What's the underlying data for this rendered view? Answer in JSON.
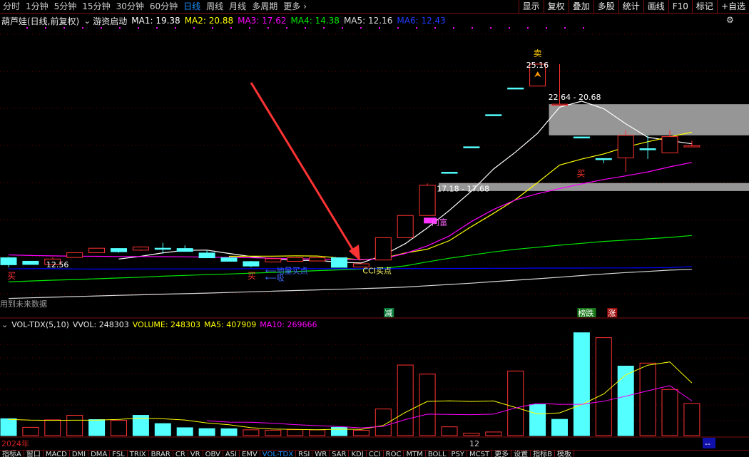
{
  "toolbar": {
    "periods": [
      {
        "label": "分时"
      },
      {
        "label": "1分钟"
      },
      {
        "label": "5分钟"
      },
      {
        "label": "15分钟"
      },
      {
        "label": "30分钟"
      },
      {
        "label": "60分钟"
      },
      {
        "label": "日线",
        "active": true
      },
      {
        "label": "周线"
      },
      {
        "label": "月线"
      },
      {
        "label": "多周期"
      },
      {
        "label": "更多"
      }
    ],
    "more_arrow": "›",
    "tools": [
      "显示",
      "复权",
      "叠加",
      "多股",
      "统计",
      "画线",
      "F10",
      "标记",
      "+自选"
    ]
  },
  "main_info": {
    "stock": "葫芦娃(日线,前复权)",
    "chevron": "⌄",
    "indicator": "游资启动",
    "ma1": "MA1: 19.38",
    "ma2": "MA2: 20.88",
    "ma3": "MA3: 17.62",
    "ma4": "MA4: 14.38",
    "ma5": "MA5: 12.16",
    "ma6": "MA6: 12.43",
    "settings_icon": "gear-icon"
  },
  "colors": {
    "up": "#ff3232",
    "down": "#54ffff",
    "ma1": "#ffffff",
    "ma2": "#ffff00",
    "ma3": "#ff00ff",
    "ma4": "#00e600",
    "ma5": "#0000ff",
    "ma6": "#0000ff",
    "zone": "#c0c0c0",
    "arrow": "#ff3333",
    "label_green": "#00cc66"
  },
  "annotations": {
    "high_price": "25.16",
    "low_price": "12.56",
    "zone_upper": "22.64 - 20.68",
    "zone_lower": "17.18 - 17.68",
    "sell_label": "卖",
    "buy_label": "买",
    "suck_label": "吸",
    "asking_label": "问富",
    "ground_buy": "地量买点",
    "cci_buy": "CCI买点",
    "future_data": "用到未来数据",
    "tag_reduce": "减",
    "tag_list": "榜跌",
    "tag_rise": "涨"
  },
  "volume_info": {
    "indicator": "VOL-TDX(5,10)",
    "vvol": "VVOL: 248303",
    "volume": "VOLUME: 248303",
    "ma5": "MA5: 407909",
    "ma10": "MA10: 269666"
  },
  "time_axis": {
    "year": "2024年",
    "month": "12",
    "right_marker": "--"
  },
  "bottom_tabs": [
    {
      "label": "指标A"
    },
    {
      "label": "窗口"
    },
    {
      "label": "MACD"
    },
    {
      "label": "DMI"
    },
    {
      "label": "DMA"
    },
    {
      "label": "FSL"
    },
    {
      "label": "TRIX"
    },
    {
      "label": "BRAR"
    },
    {
      "label": "CR"
    },
    {
      "label": "VR"
    },
    {
      "label": "OBV"
    },
    {
      "label": "ASI"
    },
    {
      "label": "EMV"
    },
    {
      "label": "VOL-TDX",
      "active": true
    },
    {
      "label": "RSI"
    },
    {
      "label": "WR"
    },
    {
      "label": "SAR"
    },
    {
      "label": "KDJ"
    },
    {
      "label": "CCI"
    },
    {
      "label": "ROC"
    },
    {
      "label": "MTM"
    },
    {
      "label": "BOLL"
    },
    {
      "label": "PSY"
    },
    {
      "label": "MCST"
    },
    {
      "label": "更多"
    },
    {
      "label": "设置"
    },
    {
      "label": "指标B"
    },
    {
      "label": "模板"
    }
  ],
  "chart_data": [
    {
      "type": "candlestick",
      "title": "葫芦娃(日线,前复权)",
      "ylim": [
        10.0,
        27.4
      ],
      "candles": [
        {
          "o": 12.98,
          "c": 12.54,
          "h": 13.04,
          "l": 12.38
        },
        {
          "o": 12.76,
          "c": 12.56,
          "h": 12.76,
          "l": 12.56
        },
        {
          "o": 12.56,
          "c": 12.9,
          "h": 13.0,
          "l": 12.56
        },
        {
          "o": 13.0,
          "c": 13.3,
          "h": 13.3,
          "l": 13.0
        },
        {
          "o": 13.3,
          "c": 13.58,
          "h": 13.6,
          "l": 13.3
        },
        {
          "o": 13.56,
          "c": 13.36,
          "h": 13.58,
          "l": 13.3
        },
        {
          "o": 13.46,
          "c": 13.66,
          "h": 13.7,
          "l": 13.4
        },
        {
          "o": 13.58,
          "c": 13.56,
          "h": 13.92,
          "l": 13.24
        },
        {
          "o": 13.56,
          "c": 13.38,
          "h": 13.76,
          "l": 13.36
        },
        {
          "o": 13.28,
          "c": 12.98,
          "h": 13.46,
          "l": 12.98
        },
        {
          "o": 12.98,
          "c": 12.76,
          "h": 12.98,
          "l": 12.76
        },
        {
          "o": 12.74,
          "c": 12.46,
          "h": 12.78,
          "l": 12.38
        },
        {
          "o": 12.72,
          "c": 12.92,
          "h": 12.92,
          "l": 12.72
        },
        {
          "o": 12.76,
          "c": 12.98,
          "h": 12.98,
          "l": 12.76
        },
        {
          "o": 12.78,
          "c": 12.98,
          "h": 12.98,
          "l": 12.78
        },
        {
          "o": 12.98,
          "c": 12.38,
          "h": 12.98,
          "l": 12.38
        },
        {
          "o": 12.4,
          "c": 12.6,
          "h": 12.64,
          "l": 12.4
        },
        {
          "o": 12.84,
          "c": 14.24,
          "h": 14.24,
          "l": 12.84
        },
        {
          "o": 14.24,
          "c": 15.64,
          "h": 15.64,
          "l": 14.24
        },
        {
          "o": 15.64,
          "c": 17.54,
          "h": 17.66,
          "l": 15.64
        },
        {
          "o": 18.36,
          "c": 18.34,
          "h": 18.36,
          "l": 18.32
        },
        {
          "o": 19.96,
          "c": 19.94,
          "h": 19.96,
          "l": 19.92
        },
        {
          "o": 21.98,
          "c": 21.96,
          "h": 21.98,
          "l": 21.94
        },
        {
          "o": 23.66,
          "c": 23.64,
          "h": 23.66,
          "l": 23.62
        },
        {
          "o": 23.78,
          "c": 25.16,
          "h": 25.16,
          "l": 23.78
        },
        {
          "o": 22.64,
          "c": 22.64,
          "h": 25.16,
          "l": 22.6
        },
        {
          "o": 20.58,
          "c": 20.56,
          "h": 20.58,
          "l": 20.54
        },
        {
          "o": 19.22,
          "c": 19.2,
          "h": 19.22,
          "l": 18.92
        },
        {
          "o": 19.26,
          "c": 20.68,
          "h": 21.0,
          "l": 18.38
        },
        {
          "o": 19.84,
          "c": 19.8,
          "h": 20.68,
          "l": 19.2
        },
        {
          "o": 19.58,
          "c": 20.6,
          "h": 21.0,
          "l": 19.56
        },
        {
          "o": 20.0,
          "c": 20.02,
          "h": 20.34,
          "l": 19.98
        }
      ],
      "ma_series": [
        {
          "name": "MA1",
          "values": [
            null,
            null,
            null,
            null,
            null,
            12.9,
            13.07,
            13.29,
            13.45,
            13.46,
            13.25,
            13.06,
            12.91,
            12.81,
            12.82,
            12.7,
            12.65,
            13.14,
            13.87,
            14.86,
            15.96,
            17.17,
            18.56,
            19.63,
            20.81,
            22.45,
            22.83,
            22.36,
            21.41,
            20.56,
            20.35,
            20.15
          ]
        },
        {
          "name": "MA2",
          "values": [
            null,
            null,
            null,
            null,
            null,
            null,
            null,
            null,
            null,
            null,
            13.07,
            13.08,
            13.08,
            13.1,
            13.09,
            12.97,
            12.85,
            12.95,
            13.28,
            13.52,
            14.06,
            14.94,
            15.77,
            16.64,
            17.71,
            18.81,
            19.19,
            19.51,
            19.94,
            20.28,
            20.59,
            20.88
          ]
        },
        {
          "name": "MA3",
          "values": [
            13.16,
            13.12,
            13.1,
            13.08,
            13.07,
            13.06,
            13.06,
            13.05,
            13.04,
            13.02,
            13.0,
            12.98,
            12.95,
            12.92,
            12.9,
            12.88,
            12.87,
            12.92,
            13.25,
            13.73,
            14.36,
            15.26,
            16.02,
            16.62,
            17.01,
            17.33,
            17.63,
            17.9,
            18.13,
            18.38,
            18.7,
            18.98
          ]
        },
        {
          "name": "MA4",
          "values": [
            11.46,
            11.52,
            11.57,
            11.61,
            11.66,
            11.71,
            11.76,
            11.82,
            11.87,
            11.92,
            11.96,
            12.01,
            12.06,
            12.11,
            12.17,
            12.22,
            12.27,
            12.32,
            12.47,
            12.72,
            12.95,
            13.15,
            13.35,
            13.51,
            13.64,
            13.77,
            13.89,
            14.01,
            14.09,
            14.17,
            14.26,
            14.38
          ]
        },
        {
          "name": "MA5",
          "values": [
            12.28,
            12.29,
            12.29,
            12.28,
            12.27,
            12.27,
            12.28,
            12.28,
            12.28,
            12.28,
            12.28,
            12.29,
            12.29,
            12.29,
            12.29,
            12.29,
            12.29,
            12.29,
            12.3,
            12.3,
            12.31,
            12.31,
            12.32,
            12.32,
            12.33,
            12.33,
            12.33,
            12.34,
            12.34,
            12.35,
            12.36,
            12.43
          ]
        },
        {
          "name": "MA6",
          "values": [
            10.42,
            10.46,
            10.5,
            10.54,
            10.58,
            10.62,
            10.65,
            10.69,
            10.72,
            10.76,
            10.8,
            10.84,
            10.88,
            10.92,
            10.96,
            11.0,
            11.04,
            11.08,
            11.14,
            11.22,
            11.3,
            11.38,
            11.48,
            11.57,
            11.66,
            11.76,
            11.86,
            11.96,
            12.05,
            12.12,
            12.2,
            12.25
          ]
        }
      ],
      "zones": [
        {
          "low": 20.68,
          "high": 22.64,
          "from_index": 25,
          "label": "22.64 - 20.68"
        },
        {
          "low": 17.18,
          "high": 17.68,
          "from_index": 20,
          "label": "17.18 - 17.68"
        }
      ]
    },
    {
      "type": "bar",
      "title": "VOL-TDX(5,10)",
      "ylim": [
        0,
        800000
      ],
      "volumes": [
        131000,
        64000,
        122000,
        157000,
        124000,
        118000,
        157000,
        93000,
        61000,
        54000,
        53000,
        45000,
        42000,
        46000,
        44000,
        64000,
        41000,
        206000,
        546000,
        476000,
        68000,
        19000,
        28000,
        500000,
        240000,
        126000,
        796000,
        758000,
        538000,
        561000,
        357000,
        248303
      ],
      "up": [
        false,
        true,
        true,
        true,
        false,
        true,
        false,
        false,
        false,
        false,
        false,
        true,
        true,
        true,
        true,
        false,
        true,
        true,
        true,
        true,
        true,
        true,
        true,
        true,
        false,
        false,
        false,
        true,
        false,
        true,
        true,
        true
      ],
      "ma_series": [
        {
          "name": "MA5",
          "values": [
            125000,
            120000,
            118000,
            119000,
            120000,
            125000,
            136000,
            130000,
            121000,
            98000,
            84000,
            61000,
            51000,
            48000,
            46000,
            50000,
            48000,
            79000,
            180000,
            265000,
            269000,
            264000,
            268000,
            218000,
            167000,
            176000,
            240000,
            322000,
            470000,
            545000,
            570000,
            407909
          ]
        },
        {
          "name": "MA10",
          "values": [
            null,
            null,
            null,
            null,
            null,
            null,
            null,
            null,
            null,
            114000,
            104000,
            103000,
            96000,
            85000,
            77000,
            70000,
            60000,
            72000,
            124000,
            166000,
            164000,
            162000,
            166000,
            214000,
            250000,
            242000,
            242000,
            266000,
            305000,
            347000,
            387000,
            269666
          ]
        }
      ]
    }
  ]
}
